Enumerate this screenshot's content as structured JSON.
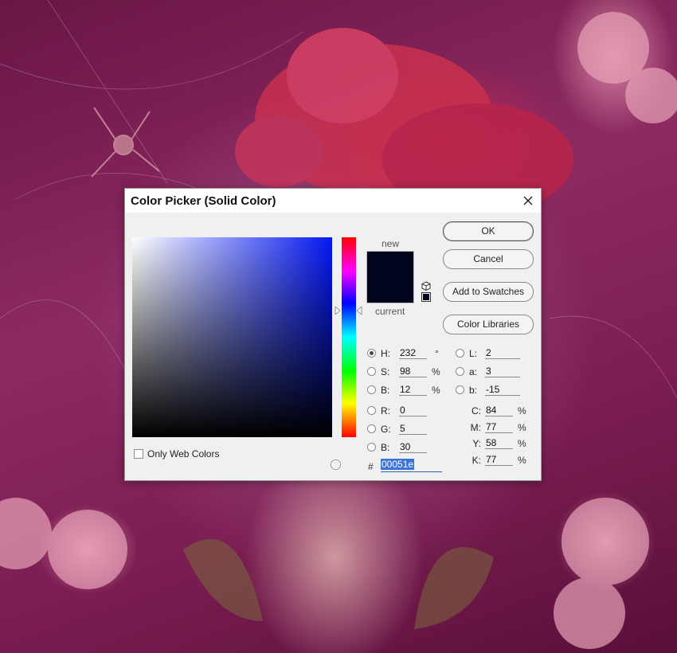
{
  "dialog": {
    "title": "Color Picker (Solid Color)",
    "ok_label": "OK",
    "cancel_label": "Cancel",
    "add_swatches_label": "Add to Swatches",
    "color_libraries_label": "Color Libraries",
    "new_label": "new",
    "current_label": "current",
    "only_web_colors_label": "Only Web Colors",
    "only_web_colors_checked": false,
    "selected_mode": "H"
  },
  "colors": {
    "new_hex": "#00051e",
    "current_hex": "#00051e",
    "hue_pure": "#0418f4"
  },
  "fields": {
    "H": {
      "label": "H:",
      "value": "232",
      "unit": "°"
    },
    "S": {
      "label": "S:",
      "value": "98",
      "unit": "%"
    },
    "Bv": {
      "label": "B:",
      "value": "12",
      "unit": "%"
    },
    "R": {
      "label": "R:",
      "value": "0"
    },
    "G": {
      "label": "G:",
      "value": "5"
    },
    "Bc": {
      "label": "B:",
      "value": "30"
    },
    "L": {
      "label": "L:",
      "value": "2"
    },
    "a": {
      "label": "a:",
      "value": "3"
    },
    "b": {
      "label": "b:",
      "value": "-15"
    },
    "C": {
      "label": "C:",
      "value": "84",
      "unit": "%"
    },
    "M": {
      "label": "M:",
      "value": "77",
      "unit": "%"
    },
    "Y": {
      "label": "Y:",
      "value": "58",
      "unit": "%"
    },
    "K": {
      "label": "K:",
      "value": "77",
      "unit": "%"
    },
    "hash": "#",
    "hex": "00051e"
  }
}
